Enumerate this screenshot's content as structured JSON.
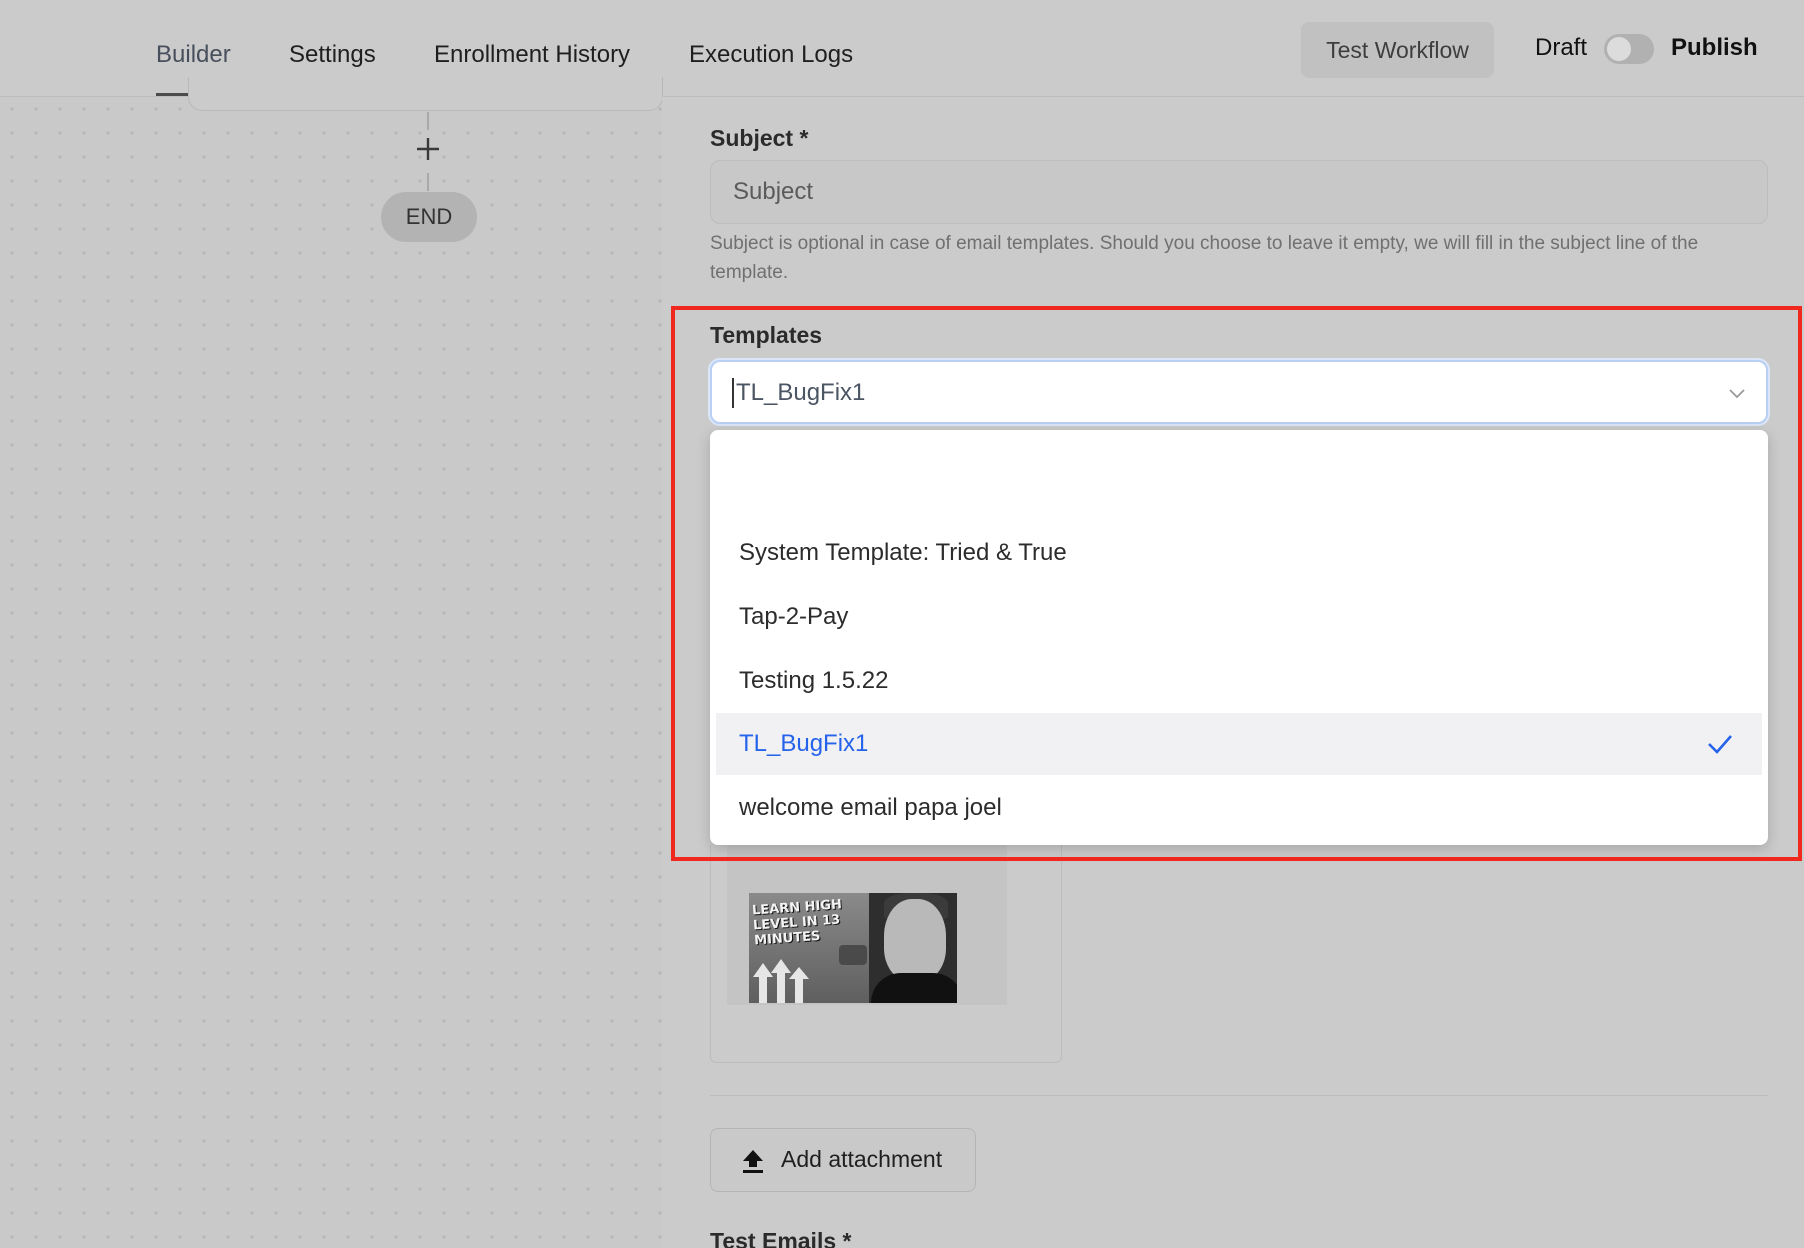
{
  "nav": {
    "tabs": [
      {
        "label": "Builder",
        "active": true
      },
      {
        "label": "Settings",
        "active": false
      },
      {
        "label": "Enrollment History",
        "active": false
      },
      {
        "label": "Execution Logs",
        "active": false
      }
    ],
    "test_workflow_label": "Test Workflow",
    "draft_label": "Draft",
    "publish_label": "Publish",
    "publish_toggle_on": false
  },
  "canvas": {
    "end_label": "END",
    "add_step_icon": "plus-icon"
  },
  "form": {
    "subject": {
      "label": "Subject *",
      "placeholder": "Subject",
      "help": "Subject is optional in case of email templates. Should you choose to leave it empty, we will fill in the subject line of the template."
    },
    "templates": {
      "label": "Templates",
      "selected": "TL_BugFix1",
      "options": [
        {
          "label": "System Template: Tried & True",
          "selected": false
        },
        {
          "label": "Tap-2-Pay",
          "selected": false
        },
        {
          "label": "Testing 1.5.22",
          "selected": false
        },
        {
          "label": "TL_BugFix1",
          "selected": true
        },
        {
          "label": "welcome email papa joel",
          "selected": false
        }
      ]
    },
    "preview": {
      "thumbnail_text": "LEARN HIGH LEVEL IN 13 MINUTES"
    },
    "attachment": {
      "button_label": "Add attachment",
      "icon": "upload-icon"
    },
    "test_emails": {
      "label": "Test Emails *"
    }
  },
  "colors": {
    "accent": "#2563eb",
    "highlight_border": "#f0281e"
  }
}
